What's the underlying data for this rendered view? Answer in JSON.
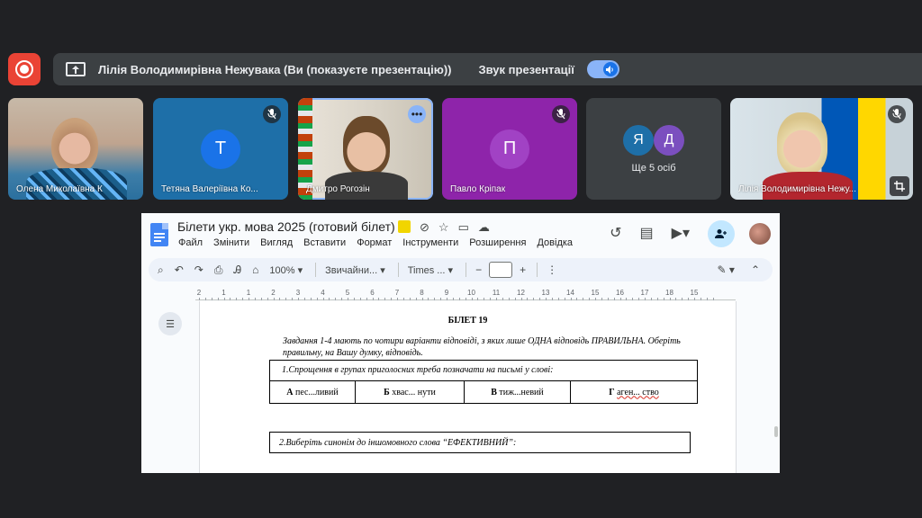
{
  "presenting": {
    "title": "Лілія Володимирівна Нежувака (Ви (показуєте презентацію))",
    "sound_label": "Звук презентації",
    "sound_on": true
  },
  "participants": [
    {
      "name": "Олена Миколаївна К",
      "type": "video",
      "muted": false
    },
    {
      "name": "Тетяна Валеріївна Ко...",
      "type": "avatar",
      "initial": "Т",
      "bg": "#1e6fa8",
      "avatar_color": "#1a73e8",
      "muted": true
    },
    {
      "name": "Дмитро Рогозін",
      "type": "video",
      "muted": false,
      "active_speaker": true
    },
    {
      "name": "Павло Кріпак",
      "type": "avatar",
      "initial": "П",
      "bg": "#8e24aa",
      "avatar_color": "#a142c4",
      "muted": true
    },
    {
      "name": "Ще 5 осіб",
      "type": "overflow",
      "initials": [
        "Я",
        "Д"
      ]
    },
    {
      "name": "Лілія Володимирівна Нежу...",
      "type": "video",
      "muted": true
    }
  ],
  "docs": {
    "title": "Білети укр. мова 2025 (готовий білет)",
    "menu": [
      "Файл",
      "Змінити",
      "Вигляд",
      "Вставити",
      "Формат",
      "Інструменти",
      "Розширення",
      "Довідка"
    ],
    "toolbar": {
      "zoom": "100%",
      "style": "Звичайни...",
      "font": "Times ..."
    },
    "ruler_labels": [
      "2",
      "1",
      "1",
      "2",
      "3",
      "4",
      "5",
      "6",
      "7",
      "8",
      "9",
      "10",
      "11",
      "12",
      "13",
      "14",
      "15",
      "16",
      "17",
      "18",
      "15"
    ],
    "content": {
      "ticket": "БІЛЕТ 19",
      "instructions": "Завдання 1-4 мають по чотири варіанти відповіді, з яких лише ОДНА відповідь ПРАВИЛЬНА. Оберіть правильну, на Вашу думку, відповідь.",
      "q1": "1.Спрощення в групах приголосних треба позначати на письмі у слові:",
      "q1_options": [
        {
          "letter": "А",
          "text": "пес...ливий"
        },
        {
          "letter": "Б",
          "text": "хвас... нути"
        },
        {
          "letter": "В",
          "text": "тиж...невий"
        },
        {
          "letter": "Г",
          "text": "аген... ство"
        }
      ],
      "q2": "2.Виберіть синонім до іншомовного слова “ЕФЕКТИВНИЙ”:"
    }
  }
}
